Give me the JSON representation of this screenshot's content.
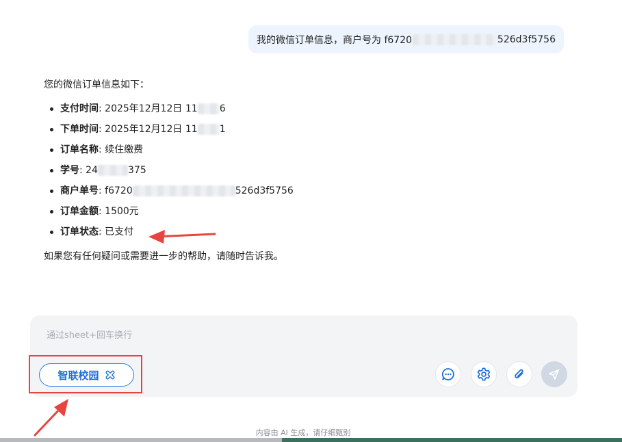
{
  "user_message": {
    "prefix": "我的微信订单信息，商户号为 f6720",
    "suffix": "526d3f5756"
  },
  "answer": {
    "intro": "您的微信订单信息如下：",
    "items": [
      {
        "label": "支付时间",
        "sep": ": ",
        "value": "2025年12月12日 11",
        "tail": "6"
      },
      {
        "label": "下单时间",
        "sep": ": ",
        "value": "2025年12月12日 11",
        "tail": "1"
      },
      {
        "label": "订单名称",
        "sep": ": ",
        "value": "续住缴费",
        "tail": ""
      },
      {
        "label": "学号",
        "sep": ": ",
        "value": "24",
        "tail": "375"
      },
      {
        "label": "商户单号",
        "sep": ": ",
        "value": "f6720",
        "tail": "526d3f5756"
      },
      {
        "label": "订单金额",
        "sep": ": ",
        "value": "1500元",
        "tail": ""
      },
      {
        "label": "订单状态",
        "sep": ": ",
        "value": "已支付",
        "tail": ""
      }
    ],
    "outro": "如果您有任何疑问或需要进一步的帮助，请随时告诉我。"
  },
  "composer": {
    "placeholder": "通过sheet+回车换行",
    "agent_label": "智联校园",
    "icons": {
      "agent": "link-icon",
      "chat": "chat-bubble-icon",
      "settings": "gear-icon",
      "attach": "paperclip-icon",
      "send": "send-icon"
    }
  },
  "footer": {
    "note": "内容由 AI 生成，请仔细甄别"
  },
  "colors": {
    "accent": "#1f6fd6",
    "annotation": "#e8443f",
    "bubble": "#eef4fd",
    "composer_bg": "#f3f4f6"
  }
}
